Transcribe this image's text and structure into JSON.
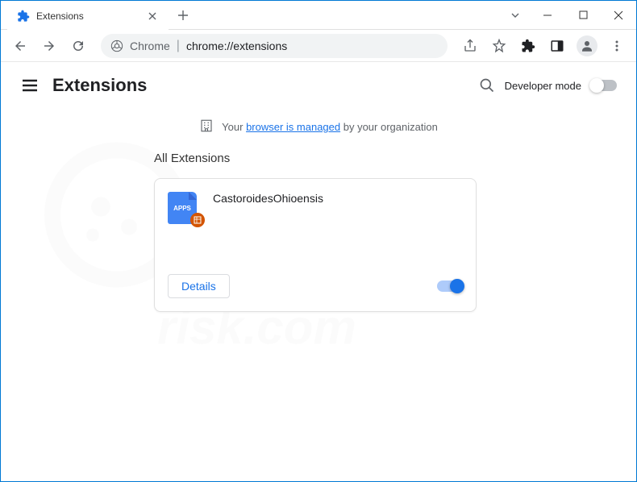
{
  "tab": {
    "title": "Extensions"
  },
  "address": {
    "prefix": "Chrome",
    "path": "chrome://extensions"
  },
  "header": {
    "title": "Extensions",
    "dev_mode": "Developer mode"
  },
  "managed": {
    "prefix": "Your ",
    "link": "browser is managed",
    "suffix": " by your organization"
  },
  "section": {
    "title": "All Extensions"
  },
  "extension": {
    "icon_text": "APPS",
    "name": "CastoroidesOhioensis",
    "details": "Details"
  }
}
